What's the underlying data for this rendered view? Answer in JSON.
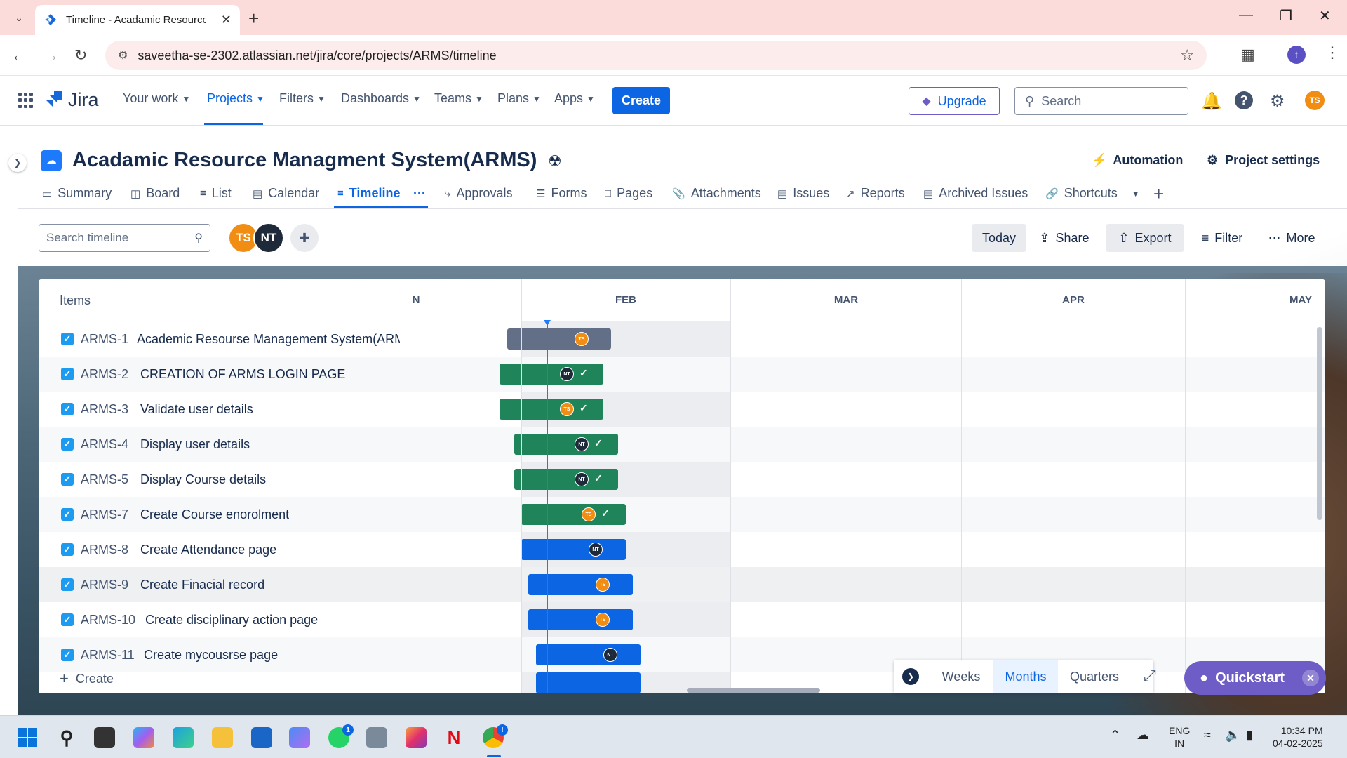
{
  "browser": {
    "tab_title": "Timeline - Acadamic Resource M",
    "url": "saveetha-se-2302.atlassian.net/jira/core/projects/ARMS/timeline",
    "profile_initial": "t"
  },
  "jira_nav": {
    "logo": "Jira",
    "items": [
      "Your work",
      "Projects",
      "Filters",
      "Dashboards",
      "Teams",
      "Plans",
      "Apps"
    ],
    "active": "Projects",
    "create": "Create",
    "upgrade": "Upgrade",
    "search_placeholder": "Search",
    "avatar": "TS"
  },
  "project": {
    "title": "Acadamic Resource Managment System(ARMS)",
    "automation": "Automation",
    "settings": "Project settings",
    "tabs": [
      "Summary",
      "Board",
      "List",
      "Calendar",
      "Timeline",
      "Approvals",
      "Forms",
      "Pages",
      "Attachments",
      "Issues",
      "Reports",
      "Archived Issues",
      "Shortcuts"
    ],
    "active_tab": "Timeline"
  },
  "toolbar": {
    "search_placeholder": "Search timeline",
    "avatars": [
      "TS",
      "NT"
    ],
    "today": "Today",
    "share": "Share",
    "export": "Export",
    "filter": "Filter",
    "more": "More"
  },
  "timeline": {
    "items_header": "Items",
    "months": [
      "N",
      "FEB",
      "MAR",
      "APR",
      "MAY"
    ],
    "rows": [
      {
        "key": "ARMS-1",
        "summary": "Academic Resourse Management System(ARM...",
        "status": "grey",
        "assignee": "TS",
        "done": false
      },
      {
        "key": "ARMS-2",
        "summary": "CREATION OF ARMS LOGIN PAGE",
        "status": "green",
        "assignee": "NT",
        "done": true
      },
      {
        "key": "ARMS-3",
        "summary": "Validate user details",
        "status": "green",
        "assignee": "TS",
        "done": true
      },
      {
        "key": "ARMS-4",
        "summary": "Display user details",
        "status": "green",
        "assignee": "NT",
        "done": true
      },
      {
        "key": "ARMS-5",
        "summary": "Display Course details",
        "status": "green",
        "assignee": "NT",
        "done": true
      },
      {
        "key": "ARMS-7",
        "summary": "Create Course enorolment",
        "status": "green",
        "assignee": "TS",
        "done": true
      },
      {
        "key": "ARMS-8",
        "summary": "Create Attendance page",
        "status": "blue",
        "assignee": "NT",
        "done": false
      },
      {
        "key": "ARMS-9",
        "summary": "Create Finacial record",
        "status": "blue",
        "assignee": "TS",
        "done": false
      },
      {
        "key": "ARMS-10",
        "summary": "Create disciplinary action page",
        "status": "blue",
        "assignee": "TS",
        "done": false
      },
      {
        "key": "ARMS-11",
        "summary": "Create mycousrse page",
        "status": "blue",
        "assignee": "NT",
        "done": false
      }
    ],
    "create_label": "Create",
    "zoom": {
      "options": [
        "Weeks",
        "Months",
        "Quarters"
      ],
      "active": "Months"
    },
    "quickstart": "Quickstart"
  },
  "taskbar": {
    "lang": "ENG",
    "region": "IN",
    "time": "10:34 PM",
    "date": "04-02-2025",
    "whatsapp_badge": "1",
    "chrome_badge": "!"
  }
}
